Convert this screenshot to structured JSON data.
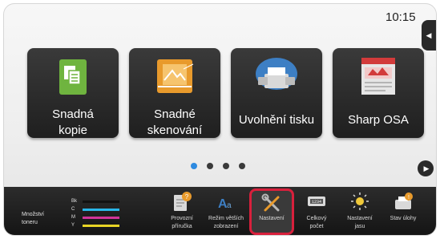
{
  "status": {
    "time": "10:15"
  },
  "tiles": [
    {
      "label": "Snadná\nkopie",
      "icon": "copy-icon"
    },
    {
      "label": "Snadné\nskenování",
      "icon": "scanner-icon"
    },
    {
      "label": "Uvolnění tisku",
      "icon": "print-release-icon"
    },
    {
      "label": "Sharp OSA",
      "icon": "sharp-osa-icon"
    }
  ],
  "pager": {
    "pages": 4,
    "active": 1
  },
  "toner": {
    "label": "Množství\ntoneru",
    "channels": [
      {
        "name": "Bk",
        "color": "#111111"
      },
      {
        "name": "C",
        "color": "#29b6e8"
      },
      {
        "name": "M",
        "color": "#d0349a"
      },
      {
        "name": "Y",
        "color": "#e8d425"
      }
    ]
  },
  "shortcuts": [
    {
      "label": "Provozní\npříručka",
      "icon": "manual-icon"
    },
    {
      "label": "Režim větších\nzobrazení",
      "icon": "large-text-icon"
    },
    {
      "label": "Nastavení",
      "icon": "settings-tools-icon",
      "highlighted": true
    },
    {
      "label": "Celkový\npočet",
      "icon": "counter-icon"
    },
    {
      "label": "Nastavení\njasu",
      "icon": "brightness-icon"
    },
    {
      "label": "Stav úlohy",
      "icon": "job-status-icon"
    }
  ],
  "colors": {
    "accent": "#2d8ae0",
    "highlight": "#d8203c"
  }
}
